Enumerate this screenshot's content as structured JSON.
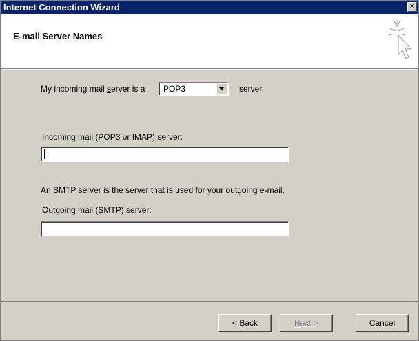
{
  "window": {
    "title": "Internet Connection Wizard",
    "close_glyph": "×"
  },
  "header": {
    "title": "E-mail Server Names",
    "icon": "wizard-cursor-sparkle-icon"
  },
  "form": {
    "incoming_type_prefix": "My incoming mail ",
    "incoming_type_accel": "s",
    "incoming_type_middle": "erver is a",
    "incoming_type_value": "POP3",
    "incoming_type_suffix": "server.",
    "incoming_server_accel": "I",
    "incoming_server_label": "ncoming mail (POP3 or IMAP) server:",
    "incoming_server_value": "",
    "smtp_description": "An SMTP server is the server that is used for your outgoing e-mail.",
    "outgoing_server_accel": "O",
    "outgoing_server_label": "utgoing mail (SMTP) server:",
    "outgoing_server_value": ""
  },
  "buttons": {
    "back_prefix": "< ",
    "back_accel": "B",
    "back_rest": "ack",
    "next_accel": "N",
    "next_rest": "ext >",
    "cancel": "Cancel"
  },
  "colors": {
    "titlebar": "#0a246a",
    "dialog_bg": "#d4d0c8",
    "header_bg": "#ffffff"
  }
}
